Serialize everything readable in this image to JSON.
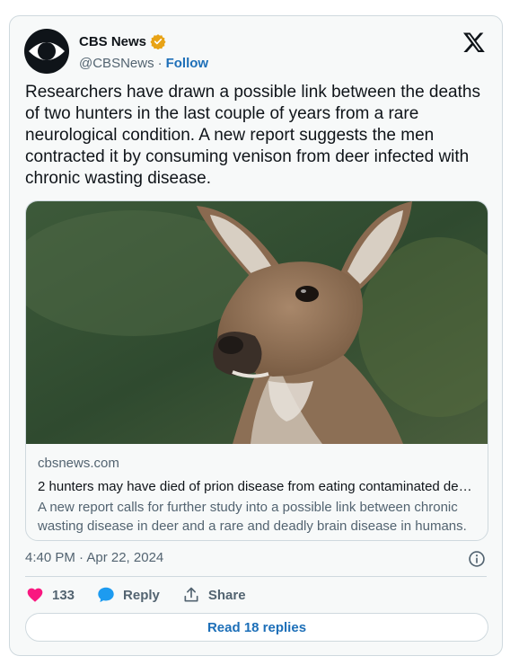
{
  "author": {
    "name": "CBS News",
    "handle": "@CBSNews",
    "separator": "·",
    "follow_label": "Follow",
    "verified_color": "#e8a316"
  },
  "platform_icon": "x-logo-icon",
  "tweet": {
    "text": "Researchers have drawn a possible link between the deaths of two hunters in the last couple of years from a rare neurological condition. A new report suggests the men contracted it by consuming venison from deer infected with chronic wasting disease."
  },
  "link_card": {
    "image": "deer-photo",
    "domain": "cbsnews.com",
    "title": "2 hunters may have died of prion disease from eating contaminated deer meat",
    "description": "A new report calls for further study into a possible link between chronic wasting disease in deer and a rare and deadly brain disease in humans."
  },
  "timestamp": "4:40 PM · Apr 22, 2024",
  "actions": {
    "like_count": "133",
    "reply_label": "Reply",
    "share_label": "Share"
  },
  "read_replies_label": "Read 18 replies",
  "colors": {
    "like": "#f91880",
    "reply": "#1d9bf0",
    "link_blue": "#1d6fb8",
    "border": "#cfd9de"
  }
}
